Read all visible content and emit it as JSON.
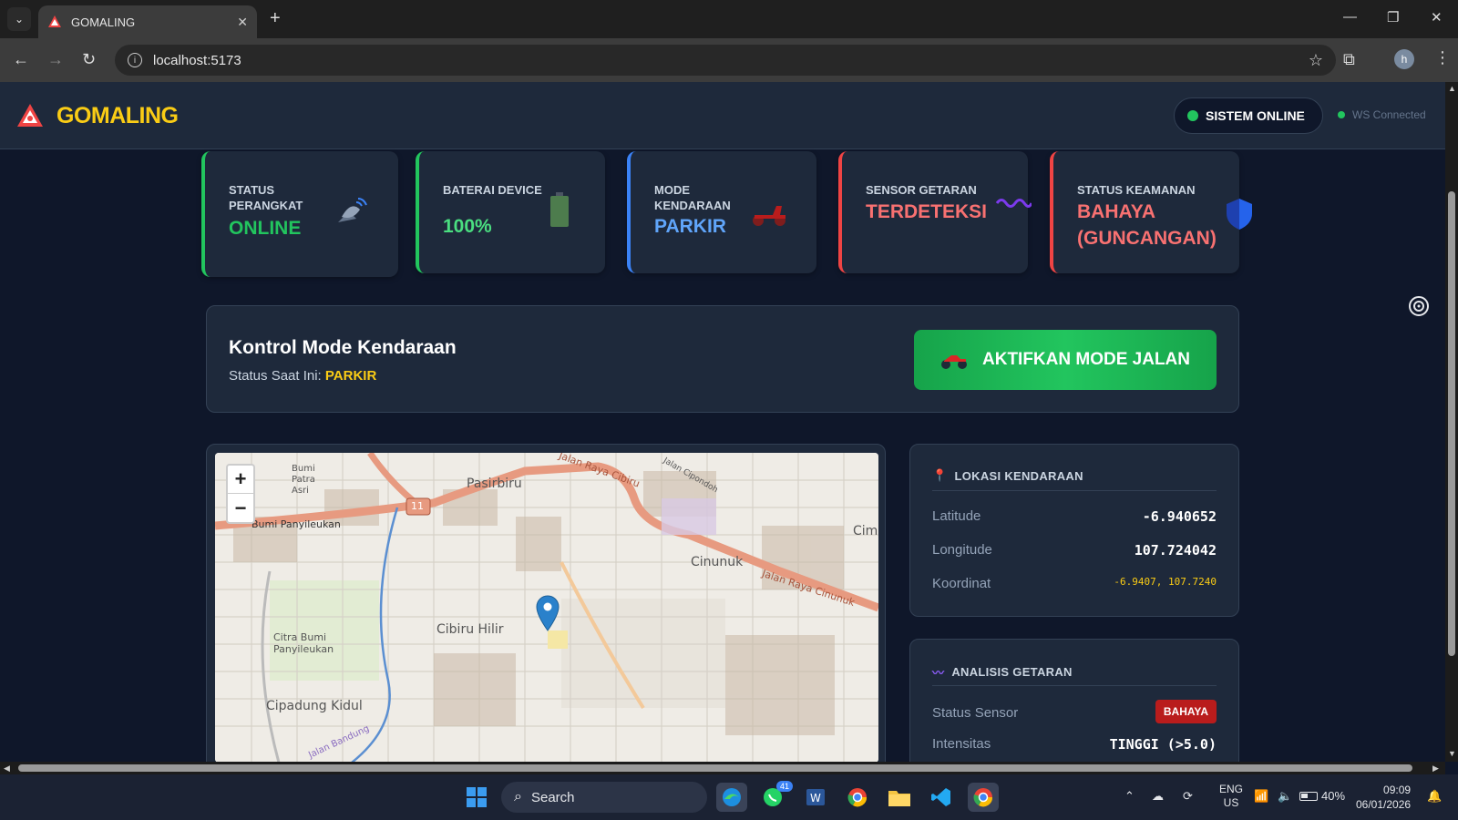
{
  "browser": {
    "tab_title": "GOMALING",
    "url": "localhost:5173"
  },
  "header": {
    "brand": "GOMALING",
    "system_status": "SISTEM ONLINE",
    "ws_status": "WS Connected"
  },
  "stats": [
    {
      "label": "STATUS PERANGKAT",
      "value": "ONLINE",
      "accent": "#22c55e",
      "value_color": "#22c55e",
      "icon": "satellite-icon"
    },
    {
      "label": "BATERAI DEVICE",
      "value": "100%",
      "accent": "#22c55e",
      "value_color": "#4ade80",
      "icon": "battery-icon"
    },
    {
      "label": "MODE KENDARAAN",
      "value": "PARKIR",
      "accent": "#3b82f6",
      "value_color": "#60a5fa",
      "icon": "scooter-icon"
    },
    {
      "label": "SENSOR GETARAN",
      "value": "TERDETEKSI",
      "accent": "#ef4444",
      "value_color": "#f87171",
      "icon": "wave-icon"
    },
    {
      "label": "STATUS KEAMANAN",
      "value": "BAHAYA (GUNCANGAN)",
      "accent": "#ef4444",
      "value_color": "#f87171",
      "icon": "shield-icon"
    }
  ],
  "mode_control": {
    "title": "Kontrol Mode Kendaraan",
    "status_prefix": "Status Saat Ini:",
    "status_value": "PARKIR",
    "button_label": "AKTIFKAN MODE JALAN"
  },
  "map": {
    "zoom_in": "+",
    "zoom_out": "−",
    "labels": [
      "Bumi Patra Asri",
      "Pasirbiru",
      "Jalan Raya Cibiru",
      "Jalan Cipondoh",
      "Bumi Panyileukan",
      "11",
      "Cinunuk",
      "Cim",
      "Jalan Raya Cinunuk",
      "Cibiru Hilir",
      "Citra Bumi Panyileukan",
      "Cipadung Kidul",
      "Jalan Bandung"
    ]
  },
  "location": {
    "title": "LOKASI KENDARAAN",
    "latitude_label": "Latitude",
    "latitude": "-6.940652",
    "longitude_label": "Longitude",
    "longitude": "107.724042",
    "coord_label": "Koordinat",
    "coord": "-6.9407, 107.7240"
  },
  "vibration": {
    "title": "ANALISIS GETARAN",
    "sensor_label": "Status Sensor",
    "sensor_value": "BAHAYA",
    "intensity_label": "Intensitas",
    "intensity_value": "TINGGI (>5.0)"
  },
  "taskbar": {
    "search": "Search",
    "whatsapp_badge": "41",
    "lang": "ENG",
    "region": "US",
    "battery": "40%",
    "time": "09:09",
    "date": "06/01/2026"
  }
}
